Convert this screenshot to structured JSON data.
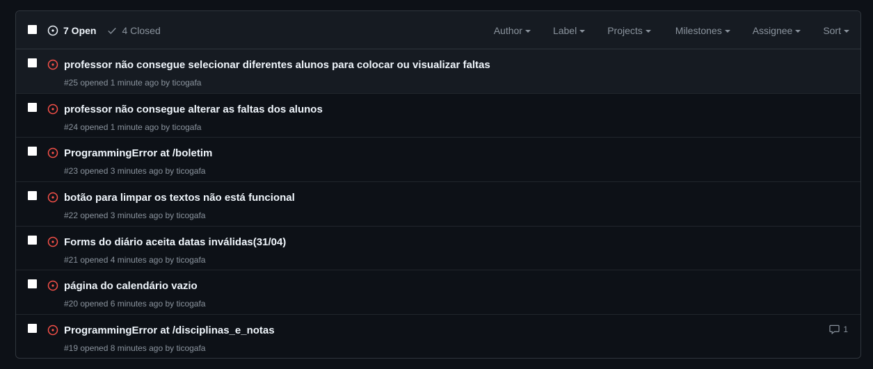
{
  "header": {
    "open_label": "7 Open",
    "closed_label": "4 Closed",
    "filters": [
      "Author",
      "Label",
      "Projects",
      "Milestones",
      "Assignee",
      "Sort"
    ]
  },
  "colors": {
    "open_icon": "#f85149",
    "background": "#0d1117",
    "header_bg": "#161b22",
    "border": "#30363d"
  },
  "issues": [
    {
      "title": "professor não consegue selecionar diferentes alunos para colocar ou visualizar faltas",
      "meta": "#25 opened 1 minute ago by ticogafa",
      "comments": ""
    },
    {
      "title": "professor não consegue alterar as faltas dos alunos",
      "meta": "#24 opened 1 minute ago by ticogafa",
      "comments": ""
    },
    {
      "title": "ProgrammingError at /boletim",
      "meta": "#23 opened 3 minutes ago by ticogafa",
      "comments": ""
    },
    {
      "title": "botão para limpar os textos não está funcional",
      "meta": "#22 opened 3 minutes ago by ticogafa",
      "comments": ""
    },
    {
      "title": "Forms do diário aceita datas inválidas(31/04)",
      "meta": "#21 opened 4 minutes ago by ticogafa",
      "comments": ""
    },
    {
      "title": "página do calendário vazio",
      "meta": "#20 opened 6 minutes ago by ticogafa",
      "comments": ""
    },
    {
      "title": "ProgrammingError at /disciplinas_e_notas",
      "meta": "#19 opened 8 minutes ago by ticogafa",
      "comments": "1"
    }
  ]
}
